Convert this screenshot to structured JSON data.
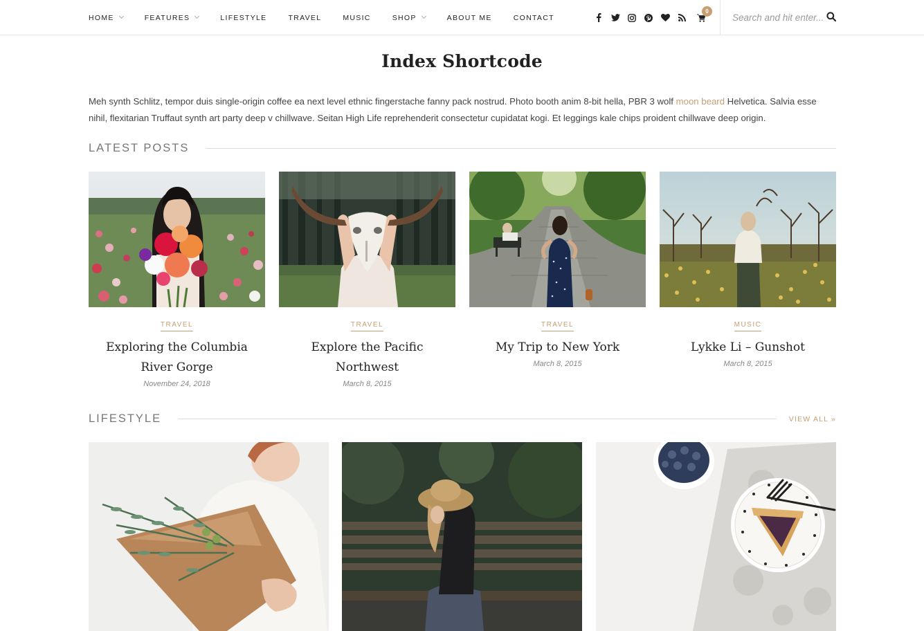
{
  "nav": {
    "items": [
      {
        "label": "HOME",
        "dropdown": true
      },
      {
        "label": "FEATURES",
        "dropdown": true
      },
      {
        "label": "LIFESTYLE",
        "dropdown": false
      },
      {
        "label": "TRAVEL",
        "dropdown": false
      },
      {
        "label": "MUSIC",
        "dropdown": false
      },
      {
        "label": "SHOP",
        "dropdown": true
      },
      {
        "label": "ABOUT ME",
        "dropdown": false
      },
      {
        "label": "CONTACT",
        "dropdown": false
      }
    ],
    "social_icons": [
      "facebook-icon",
      "twitter-icon",
      "instagram-icon",
      "pinterest-icon",
      "heart-icon",
      "rss-icon"
    ],
    "cart_count": "0",
    "search_placeholder": "Search and hit enter..."
  },
  "page": {
    "title": "Index Shortcode",
    "intro_before": "Meh synth Schlitz, tempor duis single-origin coffee ea next level ethnic fingerstache fanny pack nostrud. Photo booth anim 8-bit hella, PBR 3 wolf ",
    "intro_link": "moon beard",
    "intro_after": " Helvetica. Salvia esse nihil, flexitarian Truffaut synth art party deep v chillwave. Seitan High Life reprehenderit consectetur cupidatat kogi. Et leggings kale chips proident chillwave deep origin."
  },
  "latest": {
    "heading": "LATEST POSTS",
    "posts": [
      {
        "category": "TRAVEL",
        "title": "Exploring the Columbia River Gorge",
        "date": "November 24, 2018"
      },
      {
        "category": "TRAVEL",
        "title": "Explore the Pacific Northwest",
        "date": "March 8, 2015"
      },
      {
        "category": "TRAVEL",
        "title": "My Trip to New York",
        "date": "March 8, 2015"
      },
      {
        "category": "MUSIC",
        "title": "Lykke Li – Gunshot",
        "date": "March 8, 2015"
      }
    ]
  },
  "lifestyle": {
    "heading": "LIFESTYLE",
    "view_all": "VIEW ALL »"
  },
  "colors": {
    "accent": "#c69f73",
    "text": "#222222",
    "muted": "#777777"
  }
}
